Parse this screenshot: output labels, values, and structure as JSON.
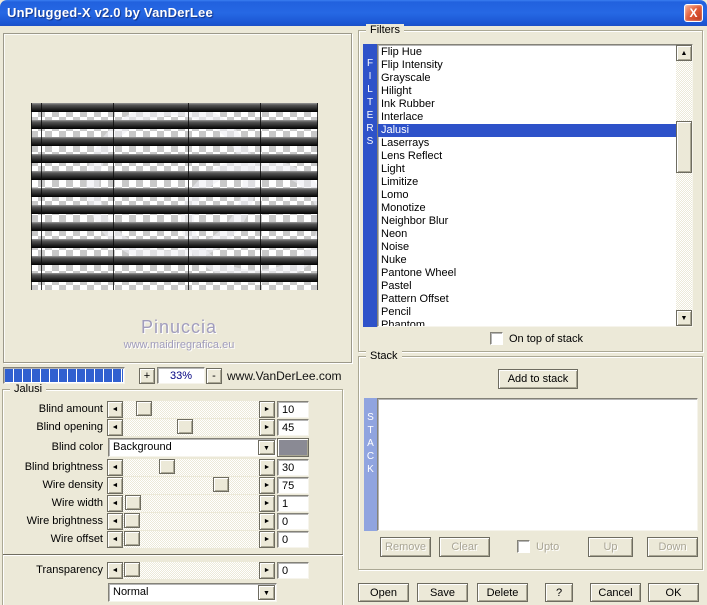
{
  "window": {
    "title": "UnPlugged-X v2.0 by VanDerLee",
    "close_glyph": "X"
  },
  "preview": {
    "watermark_name": "Pinuccia",
    "watermark_site": "www.maidiregrafica.eu"
  },
  "zoom_bar": {
    "plus_label": "+",
    "zoom_level": "33%",
    "minus_label": "-",
    "website": "www.VanDerLee.com"
  },
  "jalusi": {
    "group_label": "Jalusi",
    "sliders": [
      {
        "label": "Blind amount",
        "value": "10",
        "pos": 10
      },
      {
        "label": "Blind opening",
        "value": "45",
        "pos": 45
      },
      {
        "label": "Blind brightness",
        "value": "30",
        "pos": 30
      },
      {
        "label": "Wire density",
        "value": "75",
        "pos": 75
      },
      {
        "label": "Wire width",
        "value": "1",
        "pos": 1
      },
      {
        "label": "Wire brightness",
        "value": "0",
        "pos": 0
      },
      {
        "label": "Wire offset",
        "value": "0",
        "pos": 0
      }
    ],
    "blind_color": {
      "label": "Blind color",
      "selected_option": "Background",
      "swatch_color": "#8a8a94"
    }
  },
  "transparency": {
    "label": "Transparency",
    "value": "0",
    "pos": 0,
    "blend_mode": "Normal"
  },
  "filters": {
    "group_label": "Filters",
    "side_label": "FILTERS",
    "selected": "Jalusi",
    "items": [
      "Flip Hue",
      "Flip Intensity",
      "Grayscale",
      "Hilight",
      "Ink Rubber",
      "Interlace",
      "Jalusi",
      "Laserrays",
      "Lens Reflect",
      "Light",
      "Limitize",
      "Lomo",
      "Monotize",
      "Neighbor Blur",
      "Neon",
      "Noise",
      "Nuke",
      "Pantone Wheel",
      "Pastel",
      "Pattern Offset",
      "Pencil",
      "Phantom"
    ],
    "on_top_label": "On top of stack"
  },
  "stack": {
    "group_label": "Stack",
    "side_label": "STACK",
    "add_button": "Add to stack",
    "remove_button": "Remove",
    "clear_button": "Clear",
    "upto_label": "Upto",
    "up_button": "Up",
    "down_button": "Down"
  },
  "footer": {
    "open": "Open",
    "save": "Save",
    "delete": "Delete",
    "help": "?",
    "cancel": "Cancel",
    "ok": "OK"
  },
  "colors": {
    "dialog_bg": "#ece9d8",
    "titlebar_blue": "#2263dd",
    "selection_blue": "#2e52c9",
    "filters_bar_blue": "#2e52c9",
    "stack_bar_blue": "#90a4df",
    "progress_blue": "#3060d0",
    "zoom_text_navy": "#000080"
  }
}
